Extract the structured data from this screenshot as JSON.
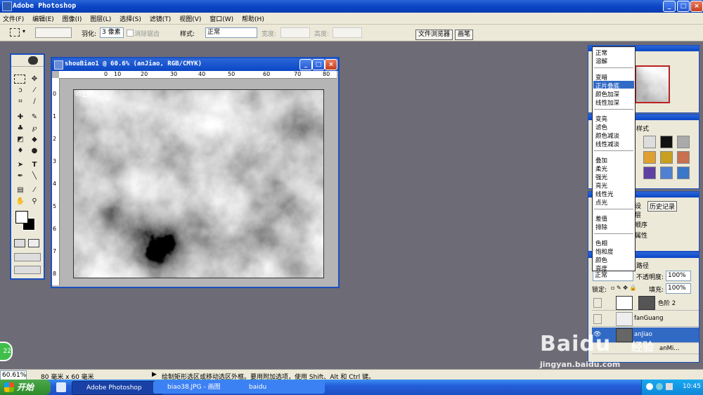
{
  "app": {
    "title": "Adobe Photoshop"
  },
  "menubar": [
    "文件(F)",
    "编辑(E)",
    "图像(I)",
    "图层(L)",
    "选择(S)",
    "滤镜(T)",
    "视图(V)",
    "窗口(W)",
    "帮助(H)"
  ],
  "options": {
    "feather_label": "羽化:",
    "feather_value": "3 像素",
    "antialias_label": "消除锯齿",
    "style_label": "样式:",
    "style_value": "正常",
    "width_label": "宽度:",
    "height_label": "高度:",
    "tab_file_browser": "文件浏览器",
    "tab_brushes": "画笔"
  },
  "document": {
    "title": "shouBiao1 @ 60.6% (anJiao, RGB/CMYK)",
    "ruler_h": [
      "0",
      "10",
      "20",
      "30",
      "40",
      "50",
      "60",
      "70",
      "80"
    ],
    "ruler_v": [
      "0",
      "1",
      "2",
      "3",
      "4",
      "5",
      "6",
      "7",
      "8"
    ],
    "canvas_badge": "01"
  },
  "blend_menu": {
    "groups": [
      [
        "正常",
        "溶解"
      ],
      [
        "变暗",
        "正片叠底",
        "颜色加深",
        "线性加深"
      ],
      [
        "变亮",
        "滤色",
        "颜色减淡",
        "线性减淡"
      ],
      [
        "叠加",
        "柔光",
        "强光",
        "亮光",
        "线性光",
        "点光"
      ],
      [
        "差值",
        "排除"
      ],
      [
        "色相",
        "饱和度",
        "颜色",
        "亮度"
      ]
    ],
    "highlighted": "正片叠底"
  },
  "panels": {
    "styles_tab": "样式",
    "history_tab_1": "设",
    "history_tab_2": "历史记录",
    "history_items": [
      "层",
      "顺序",
      "属性"
    ],
    "paths_tab": "路径"
  },
  "layers": {
    "blend_value": "正常",
    "opacity_label": "不透明度:",
    "opacity_value": "100%",
    "lock_label": "锁定:",
    "fill_label": "填充:",
    "fill_value": "100%",
    "rows": [
      {
        "name": "色阶 2"
      },
      {
        "name": "fanGuang"
      },
      {
        "name": "anJiao"
      },
      {
        "name": "anMi..."
      }
    ]
  },
  "status": {
    "zoom": "60.61%",
    "size": "80 毫米 x 60 毫米",
    "hint": "绘制矩形选区或移动选区外框。要用附加选项，使用 Shift、Alt 和 Ctrl 键。"
  },
  "taskbar": {
    "start": "开始",
    "tasks": [
      "Adobe Photoshop",
      "biao38.JPG - 画图",
      "baidu"
    ],
    "time": "10:45"
  },
  "watermark": {
    "brand": "Baidu",
    "sub": "经验",
    "url": "jingyan.baidu.com"
  },
  "badge_left": "22",
  "colors": {
    "xp_blue": "#0b46c6",
    "highlight": "#316ac5",
    "workspace": "#6d6b76"
  }
}
